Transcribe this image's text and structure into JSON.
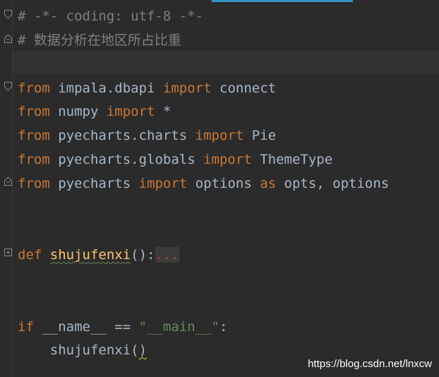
{
  "code": {
    "line1_comment": "# -*- coding: utf-8 -*-",
    "line2_comment": "# 数据分析在地区所占比重",
    "line3": {
      "kw1": "from",
      "mod": " impala.dbapi ",
      "kw2": "import",
      "name": " connect"
    },
    "line4": {
      "kw1": "from",
      "mod": " numpy ",
      "kw2": "import",
      "name": " *"
    },
    "line5": {
      "kw1": "from",
      "mod": " pyecharts.charts ",
      "kw2": "import",
      "name": " Pie"
    },
    "line6": {
      "kw1": "from",
      "mod": " pyecharts.globals ",
      "kw2": "import",
      "name": " ThemeType"
    },
    "line7": {
      "kw1": "from",
      "mod": " pyecharts ",
      "kw2": "import",
      "name": " options ",
      "kw3": "as",
      "alias": " opts, options"
    },
    "def_line": {
      "kw": "def",
      "space": " ",
      "fname": "shujufenxi",
      "rest": "():",
      "folded": "..."
    },
    "main_line": {
      "kw": "if",
      "rest": " __name__ == ",
      "str": "\"__main__\"",
      "colon": ":"
    },
    "call_line": {
      "indent": "    ",
      "fname": "shujufenxi",
      "open": "(",
      "close": ")"
    }
  },
  "watermark": "https://blog.csdn.net/lnxcw",
  "colors": {
    "background": "#2b2b2b",
    "keyword": "#cc7832",
    "comment": "#808080",
    "string": "#6a8759",
    "function": "#ffc66d",
    "text": "#a9b7c6"
  }
}
